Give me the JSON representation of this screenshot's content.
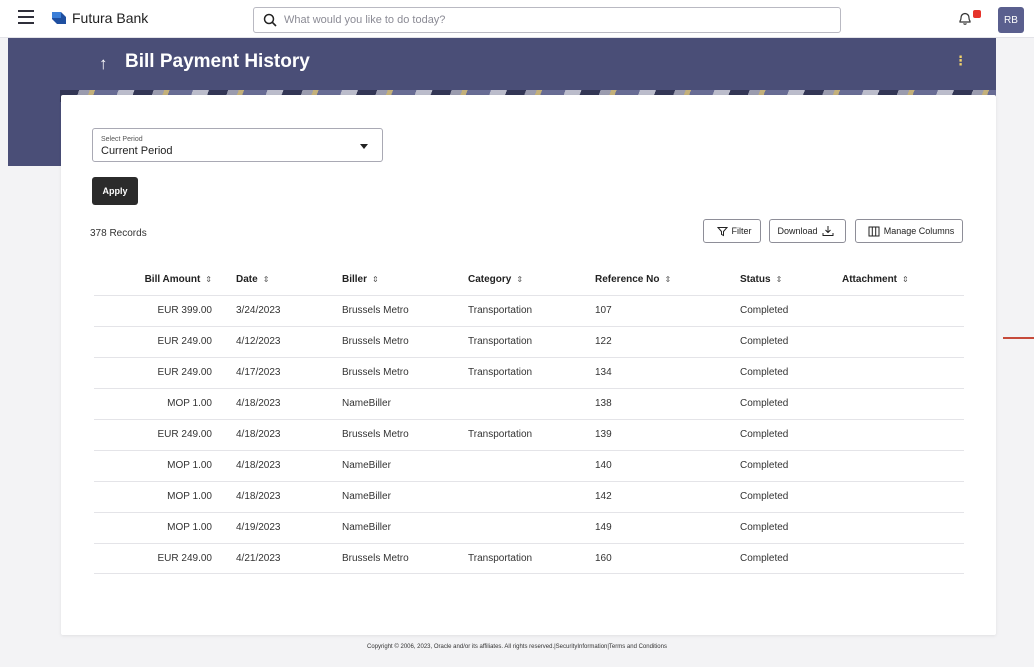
{
  "header": {
    "brand": "Futura Bank",
    "search_placeholder": "What would you like to do today?",
    "avatar_initials": "RB"
  },
  "page": {
    "title": "Bill Payment History"
  },
  "filters": {
    "period_label": "Select Period",
    "period_value": "Current Period",
    "apply_label": "Apply"
  },
  "toolbar": {
    "records": "378 Records",
    "filter_label": "Filter",
    "download_label": "Download",
    "manage_columns_label": "Manage Columns"
  },
  "table": {
    "columns": [
      "Bill Amount",
      "Date",
      "Biller",
      "Category",
      "Reference No",
      "Status",
      "Attachment"
    ],
    "rows": [
      {
        "amount": "EUR 399.00",
        "date": "3/24/2023",
        "biller": "Brussels Metro",
        "category": "Transportation",
        "ref": "107",
        "status": "Completed",
        "attachment": ""
      },
      {
        "amount": "EUR 249.00",
        "date": "4/12/2023",
        "biller": "Brussels Metro",
        "category": "Transportation",
        "ref": "122",
        "status": "Completed",
        "attachment": ""
      },
      {
        "amount": "EUR 249.00",
        "date": "4/17/2023",
        "biller": "Brussels Metro",
        "category": "Transportation",
        "ref": "134",
        "status": "Completed",
        "attachment": ""
      },
      {
        "amount": "MOP 1.00",
        "date": "4/18/2023",
        "biller": "NameBiller",
        "category": "",
        "ref": "138",
        "status": "Completed",
        "attachment": ""
      },
      {
        "amount": "EUR 249.00",
        "date": "4/18/2023",
        "biller": "Brussels Metro",
        "category": "Transportation",
        "ref": "139",
        "status": "Completed",
        "attachment": ""
      },
      {
        "amount": "MOP 1.00",
        "date": "4/18/2023",
        "biller": "NameBiller",
        "category": "",
        "ref": "140",
        "status": "Completed",
        "attachment": ""
      },
      {
        "amount": "MOP 1.00",
        "date": "4/18/2023",
        "biller": "NameBiller",
        "category": "",
        "ref": "142",
        "status": "Completed",
        "attachment": ""
      },
      {
        "amount": "MOP 1.00",
        "date": "4/19/2023",
        "biller": "NameBiller",
        "category": "",
        "ref": "149",
        "status": "Completed",
        "attachment": ""
      },
      {
        "amount": "EUR 249.00",
        "date": "4/21/2023",
        "biller": "Brussels Metro",
        "category": "Transportation",
        "ref": "160",
        "status": "Completed",
        "attachment": ""
      }
    ]
  },
  "footer": {
    "text": "Copyright © 2006, 2023, Oracle and/or its affiliates. All rights reserved.|SecurityInformation|Terms and Conditions"
  },
  "icons": {
    "menu": "hamburger-icon",
    "logo": "bank-logo-icon",
    "search": "search-icon",
    "notifications": "bell-icon",
    "back": "arrow-up-icon",
    "more": "kebab-icon",
    "dropdown": "caret-down-icon",
    "filter": "funnel-icon",
    "download": "download-icon",
    "columns": "columns-icon",
    "sort": "sort-icon"
  },
  "colors": {
    "banner": "#4a4e77",
    "primary_button": "#2b2b2b",
    "notification_badge": "#e6332a",
    "avatar": "#5a5f8e"
  }
}
